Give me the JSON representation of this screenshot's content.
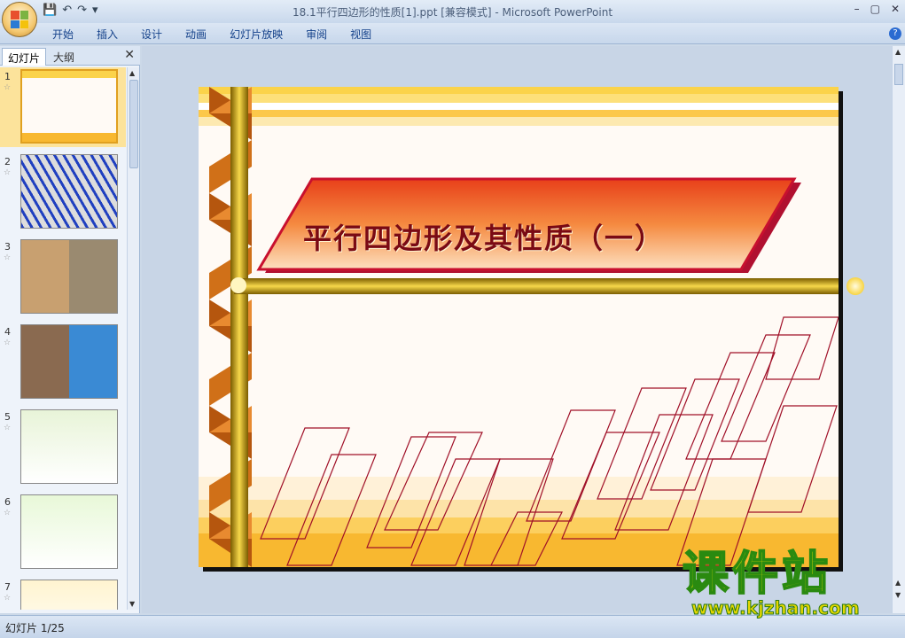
{
  "window": {
    "title": "18.1平行四边形的性质[1].ppt [兼容模式] - Microsoft PowerPoint",
    "min": "–",
    "max": "▢",
    "close": "✕"
  },
  "quick_access": {
    "save": "💾",
    "undo": "↶",
    "redo": "↷",
    "customize": "▾"
  },
  "ribbon": {
    "tabs": [
      "开始",
      "插入",
      "设计",
      "动画",
      "幻灯片放映",
      "审阅",
      "视图"
    ],
    "help": "?"
  },
  "left_pane": {
    "tab_slides": "幻灯片",
    "tab_outline": "大纲",
    "close": "✕",
    "thumbnails": [
      {
        "num": "1",
        "star": "☆"
      },
      {
        "num": "2",
        "star": "☆"
      },
      {
        "num": "3",
        "star": "☆"
      },
      {
        "num": "4",
        "star": "☆"
      },
      {
        "num": "5",
        "star": "☆"
      },
      {
        "num": "6",
        "star": "☆"
      },
      {
        "num": "7",
        "star": "☆"
      }
    ]
  },
  "slide": {
    "title": "平行四边形及其性质（一）"
  },
  "status": {
    "text": "幻灯片 1/25"
  },
  "watermark": {
    "main": "课件站",
    "url": "www.kjzhan.com"
  },
  "colors": {
    "accent": "#c8102e",
    "gold": "#f5c400",
    "ribbon_brown": "#b5560e"
  }
}
